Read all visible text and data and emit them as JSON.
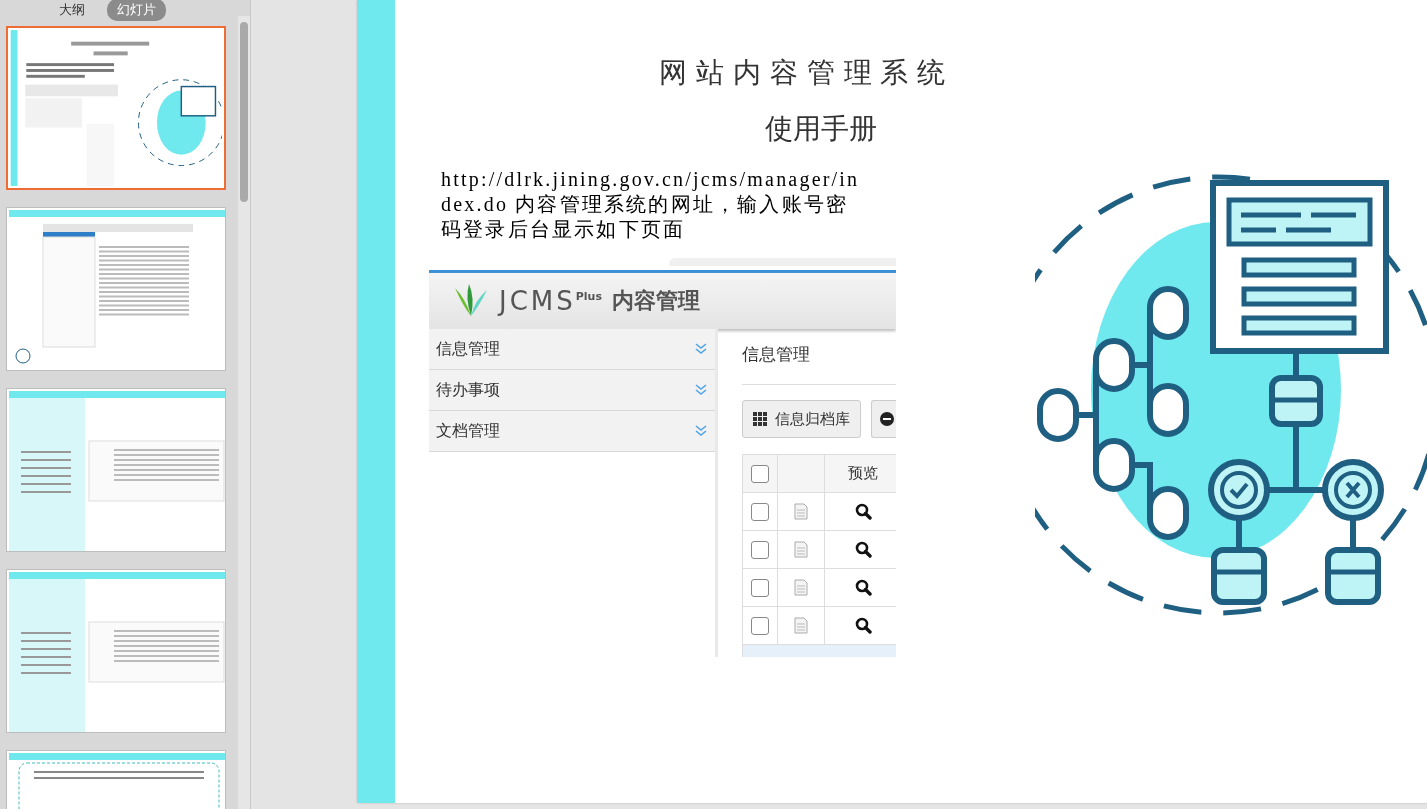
{
  "view_tabs": [
    {
      "label": "大纲",
      "selected": false
    },
    {
      "label": "幻灯片",
      "selected": true
    }
  ],
  "thumbnails": [
    {
      "kind": "cover",
      "selected": true
    },
    {
      "kind": "screenshot",
      "selected": false
    },
    {
      "kind": "split",
      "selected": false
    },
    {
      "kind": "split",
      "selected": false
    },
    {
      "kind": "boxed",
      "selected": false
    }
  ],
  "slide": {
    "title": "网 站 内 容 管 理 系 统",
    "subtitle": "使用手册",
    "body": "http://dlrk.jining.gov.cn/jcms/manager/index.do 内容管理系统的网址，输入账号密码登录后台显示如下页面",
    "screenshot": {
      "brand": "JCMS",
      "brand_sup": "Plus",
      "product": "内容管理",
      "nav_items": [
        {
          "label": "信息管理",
          "expanded": false
        },
        {
          "label": "待办事项",
          "expanded": false
        },
        {
          "label": "文档管理",
          "expanded": false
        }
      ],
      "heading": "信息管理",
      "buttons": [
        {
          "label": "信息归档库"
        }
      ],
      "table": {
        "columns": [
          "预览"
        ],
        "header_checked": false,
        "rows": [
          {
            "checked": false
          },
          {
            "checked": false
          },
          {
            "checked": false
          },
          {
            "checked": false
          }
        ]
      }
    }
  }
}
